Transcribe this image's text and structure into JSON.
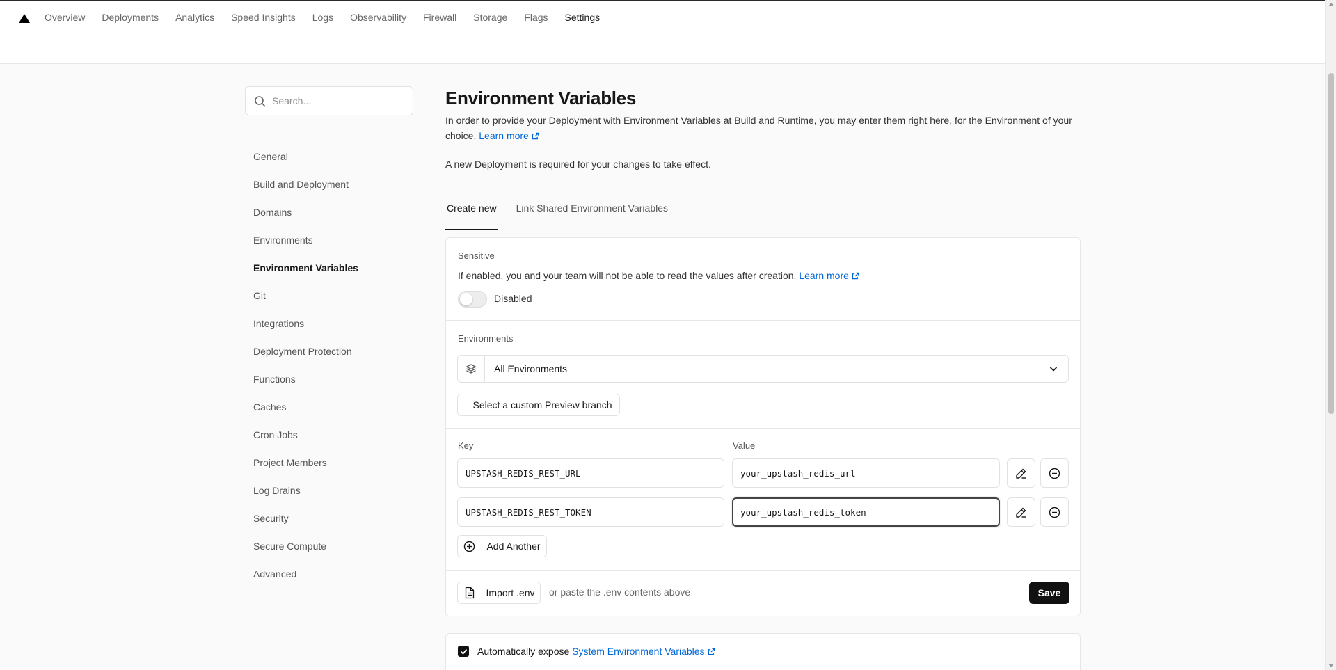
{
  "nav": {
    "items": [
      {
        "label": "Overview"
      },
      {
        "label": "Deployments"
      },
      {
        "label": "Analytics"
      },
      {
        "label": "Speed Insights"
      },
      {
        "label": "Logs"
      },
      {
        "label": "Observability"
      },
      {
        "label": "Firewall"
      },
      {
        "label": "Storage"
      },
      {
        "label": "Flags"
      },
      {
        "label": "Settings"
      }
    ],
    "active": "Settings"
  },
  "sidebar": {
    "search_placeholder": "Search...",
    "items": [
      {
        "label": "General"
      },
      {
        "label": "Build and Deployment"
      },
      {
        "label": "Domains"
      },
      {
        "label": "Environments"
      },
      {
        "label": "Environment Variables"
      },
      {
        "label": "Git"
      },
      {
        "label": "Integrations"
      },
      {
        "label": "Deployment Protection"
      },
      {
        "label": "Functions"
      },
      {
        "label": "Caches"
      },
      {
        "label": "Cron Jobs"
      },
      {
        "label": "Project Members"
      },
      {
        "label": "Log Drains"
      },
      {
        "label": "Security"
      },
      {
        "label": "Secure Compute"
      },
      {
        "label": "Advanced"
      }
    ],
    "active": "Environment Variables"
  },
  "main": {
    "title": "Environment Variables",
    "description": "In order to provide your Deployment with Environment Variables at Build and Runtime, you may enter them right here, for the Environment of your choice.",
    "learn_more": "Learn more",
    "note": "A new Deployment is required for your changes to take effect.",
    "tabs": [
      {
        "label": "Create new"
      },
      {
        "label": "Link Shared Environment Variables"
      }
    ],
    "active_tab": "Create new"
  },
  "form": {
    "sensitive": {
      "label": "Sensitive",
      "text": "If enabled, you and your team will not be able to read the values after creation.",
      "learn_more": "Learn more",
      "state_label": "Disabled"
    },
    "environments": {
      "label": "Environments",
      "selected": "All Environments",
      "preview_branch_button": "Select a custom Preview branch"
    },
    "key_label": "Key",
    "value_label": "Value",
    "rows": [
      {
        "key": "UPSTASH_REDIS_REST_URL",
        "value": "your_upstash_redis_url"
      },
      {
        "key": "UPSTASH_REDIS_REST_TOKEN",
        "value": "your_upstash_redis_token"
      }
    ],
    "add_another": "Add Another",
    "import_button": "Import .env",
    "import_hint": "or paste the .env contents above",
    "save_button": "Save"
  },
  "expose": {
    "text": "Automatically expose",
    "link": "System Environment Variables",
    "checked": true
  },
  "icons": {
    "logo": "triangle-logo-icon",
    "search": "search-icon",
    "external": "external-link-icon",
    "layers": "layers-icon",
    "chevron": "chevron-down-icon",
    "edit": "pencil-icon",
    "remove": "minus-circle-icon",
    "add": "plus-circle-icon",
    "file": "file-icon",
    "check": "check-icon"
  },
  "colors": {
    "accent_link": "#0068d6",
    "primary_button": "#111111"
  }
}
